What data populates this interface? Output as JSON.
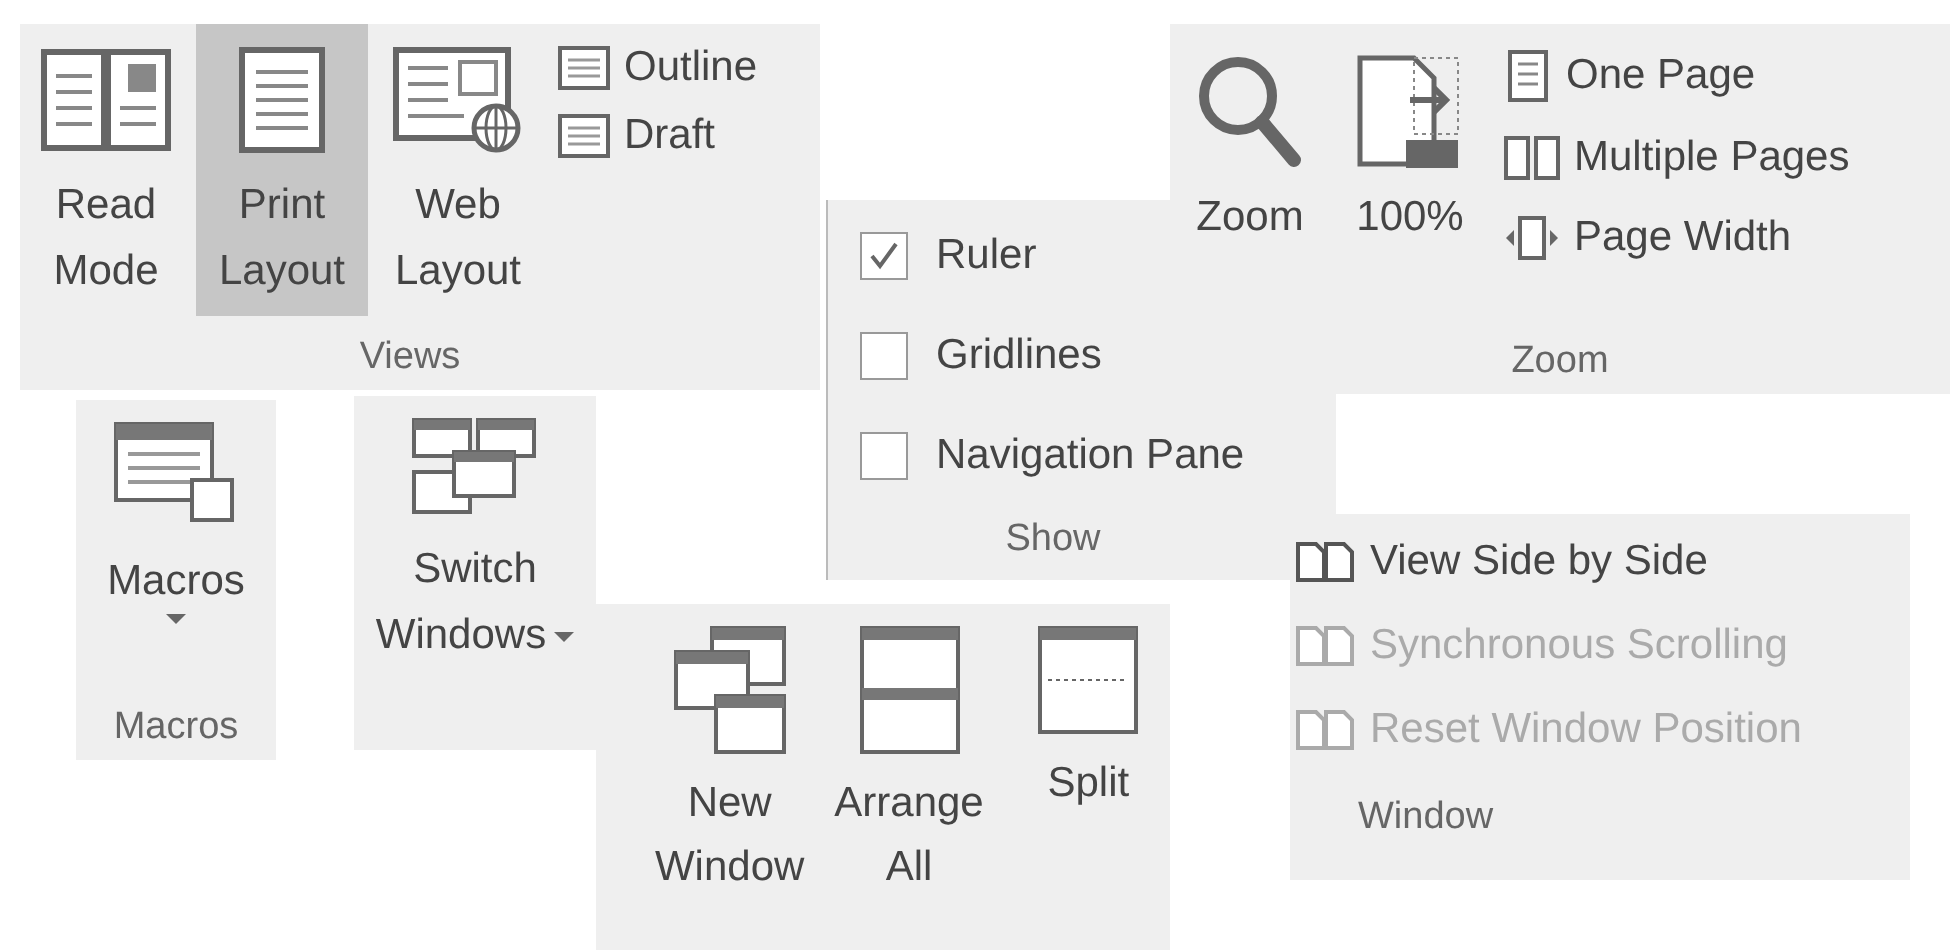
{
  "views": {
    "buttons": [
      {
        "label": "Read Mode",
        "selected": false
      },
      {
        "label": "Print Layout",
        "selected": true
      },
      {
        "label": "Web Layout",
        "selected": false
      }
    ],
    "small_buttons": [
      {
        "label": "Outline"
      },
      {
        "label": "Draft"
      }
    ],
    "group_label": "Views"
  },
  "zoom": {
    "buttons": [
      {
        "label": "Zoom"
      },
      {
        "label": "100%"
      }
    ],
    "small_buttons": [
      {
        "label": "One Page"
      },
      {
        "label": "Multiple Pages"
      },
      {
        "label": "Page Width"
      }
    ],
    "group_label": "Zoom"
  },
  "show": {
    "options": [
      {
        "label": "Ruler",
        "checked": true
      },
      {
        "label": "Gridlines",
        "checked": false
      },
      {
        "label": "Navigation Pane",
        "checked": false
      }
    ],
    "group_label": "Show"
  },
  "macros": {
    "button": {
      "label": "Macros",
      "dropdown": true
    },
    "group_label": "Macros"
  },
  "switch_windows": {
    "label": "Switch Windows",
    "dropdown": true
  },
  "window_buttons": [
    {
      "label": "New Window"
    },
    {
      "label": "Arrange All"
    },
    {
      "label": "Split"
    }
  ],
  "window": {
    "items": [
      {
        "label": "View Side by Side",
        "disabled": false
      },
      {
        "label": "Synchronous Scrolling",
        "disabled": true
      },
      {
        "label": "Reset Window Position",
        "disabled": true
      }
    ],
    "group_label": "Window"
  }
}
